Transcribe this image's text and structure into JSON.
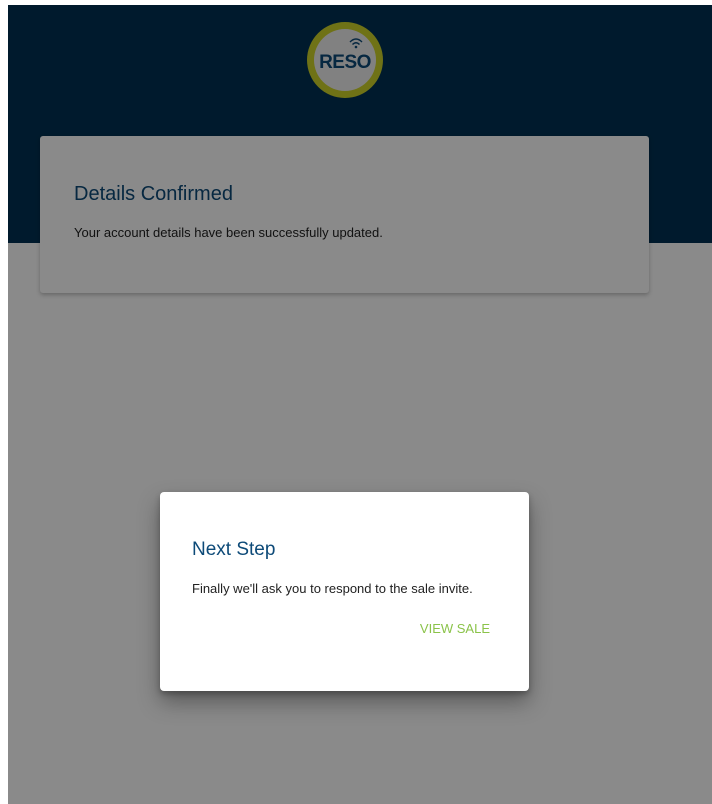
{
  "header": {
    "logo_text": "RESO",
    "logo_icon": "wifi-signal-icon",
    "background_color": "#003153",
    "logo_ring_color": "#cdd22a"
  },
  "card": {
    "title": "Details Confirmed",
    "message": "Your account details have been successfully updated."
  },
  "dialog": {
    "title": "Next Step",
    "message": "Finally we'll ask you to respond to the sale invite.",
    "action_label": "VIEW SALE",
    "action_color": "#8bc34a"
  },
  "colors": {
    "title_text": "#0d4a78",
    "body_text": "#222222"
  }
}
